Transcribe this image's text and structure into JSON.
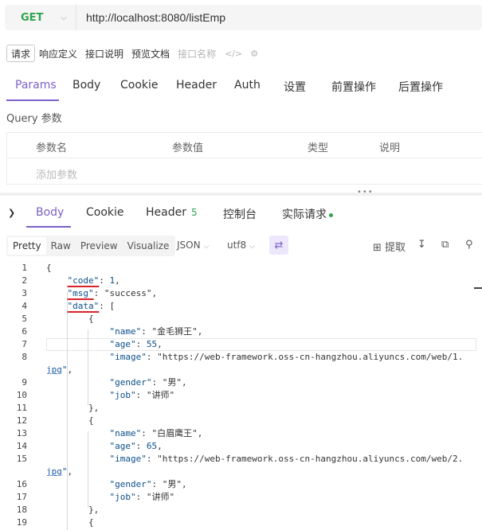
{
  "request": {
    "method": "GET",
    "url": "http://localhost:8080/listEmp"
  },
  "doc_tabs": [
    "请求",
    "响应定义",
    "接口说明",
    "预览文档"
  ],
  "doc_tab_placeholder": "接口名称",
  "request_tabs": [
    "Params",
    "Body",
    "Cookie",
    "Header",
    "Auth",
    "设置",
    "前置操作",
    "后置操作"
  ],
  "query": {
    "title": "Query 参数",
    "columns": [
      "参数名",
      "参数值",
      "类型",
      "说明"
    ],
    "add_placeholder": "添加参数"
  },
  "response_tabs": {
    "body": "Body",
    "cookie": "Cookie",
    "header": "Header",
    "header_count": "5",
    "console": "控制台",
    "actual": "实际请求"
  },
  "view": {
    "modes": [
      "Pretty",
      "Raw",
      "Preview",
      "Visualize"
    ],
    "format": "JSON",
    "encoding": "utf8",
    "extract": "提取"
  },
  "code": {
    "line_numbers": [
      "1",
      "2",
      "3",
      "4",
      "5",
      "6",
      "7",
      "8",
      "",
      "9",
      "10",
      "11",
      "12",
      "13",
      "14",
      "15",
      "",
      "16",
      "17",
      "18",
      "19"
    ],
    "lines": [
      "{",
      "    \"code\": 1,",
      "    \"msg\": \"success\",",
      "    \"data\": [",
      "        {",
      "            \"name\": \"金毛狮王\",",
      "            \"age\": 55,",
      "            \"image\": \"https://web-framework.oss-cn-hangzhou.aliyuncs.com/web/1.",
      "jpg\",",
      "            \"gender\": \"男\",",
      "            \"job\": \"讲师\"",
      "        },",
      "        {",
      "            \"name\": \"白眉鹰王\",",
      "            \"age\": 65,",
      "            \"image\": \"https://web-framework.oss-cn-hangzhou.aliyuncs.com/web/2.",
      "jpg\",",
      "            \"gender\": \"男\",",
      "            \"job\": \"讲师\"",
      "        },",
      "        {"
    ]
  },
  "colors": {
    "accent": "#7b61c9",
    "method_get": "#2ea44f",
    "json_key": "#0b4f8a",
    "json_url": "#1a5aa6",
    "highlight_underline": "#d9222a"
  }
}
